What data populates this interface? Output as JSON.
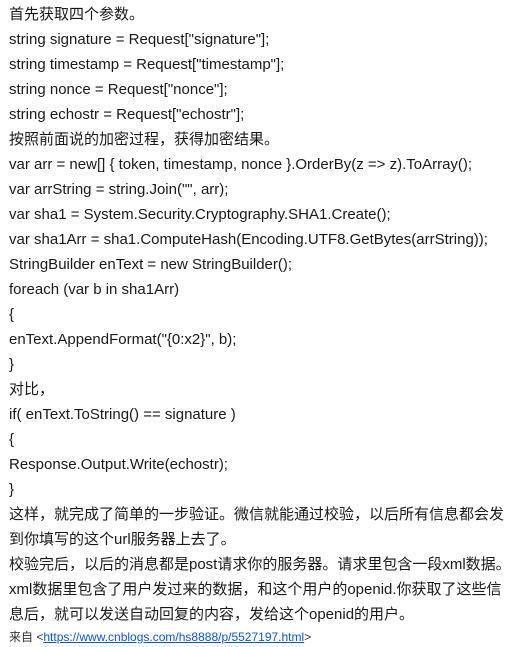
{
  "document": {
    "background_color": "#ffffff",
    "text_color": "#1a1a1a",
    "link_color": "#1155cc",
    "lines": [
      {
        "text": "首先获取四个参数。"
      },
      {
        "text": "string signature = Request[\"signature\"];"
      },
      {
        "text": "string timestamp = Request[\"timestamp\"];"
      },
      {
        "text": "string nonce = Request[\"nonce\"];"
      },
      {
        "text": "string echostr = Request[\"echostr\"];"
      },
      {
        "text": "按照前面说的加密过程，获得加密结果。"
      },
      {
        "text": "var arr = new[] { token, timestamp, nonce }.OrderBy(z => z).ToArray();"
      },
      {
        "text": "var arrString = string.Join(\"\", arr);"
      },
      {
        "text": "var sha1 = System.Security.Cryptography.SHA1.Create();"
      },
      {
        "text": "var sha1Arr = sha1.ComputeHash(Encoding.UTF8.GetBytes(arrString));"
      },
      {
        "text": "StringBuilder enText = new StringBuilder();"
      },
      {
        "text": "foreach (var b in sha1Arr)"
      },
      {
        "text": "{"
      },
      {
        "text": "enText.AppendFormat(\"{0:x2}\", b);"
      },
      {
        "text": "}"
      },
      {
        "text": "对比，"
      },
      {
        "text": "if( enText.ToString() == signature )"
      },
      {
        "text": "{"
      },
      {
        "text": "Response.Output.Write(echostr);"
      },
      {
        "text": "}"
      }
    ],
    "paragraphs": [
      {
        "text": "这样，就完成了简单的一步验证。微信就能通过校验，以后所有信息都会发到你填写的这个url服务器上去了。"
      },
      {
        "text": "校验完后，以后的消息都是post请求你的服务器。请求里包含一段xml数据。xml数据里包含了用户发过来的数据，和这个用户的openid.你获取了这些信息后，就可以发送自动回复的内容，发给这个openid的用户。"
      }
    ],
    "attribution": {
      "prefix": "来自 ",
      "open_bracket": "<",
      "url_text": "https://www.cnblogs.com/hs8888/p/5527197.html",
      "close_bracket": ">"
    }
  }
}
